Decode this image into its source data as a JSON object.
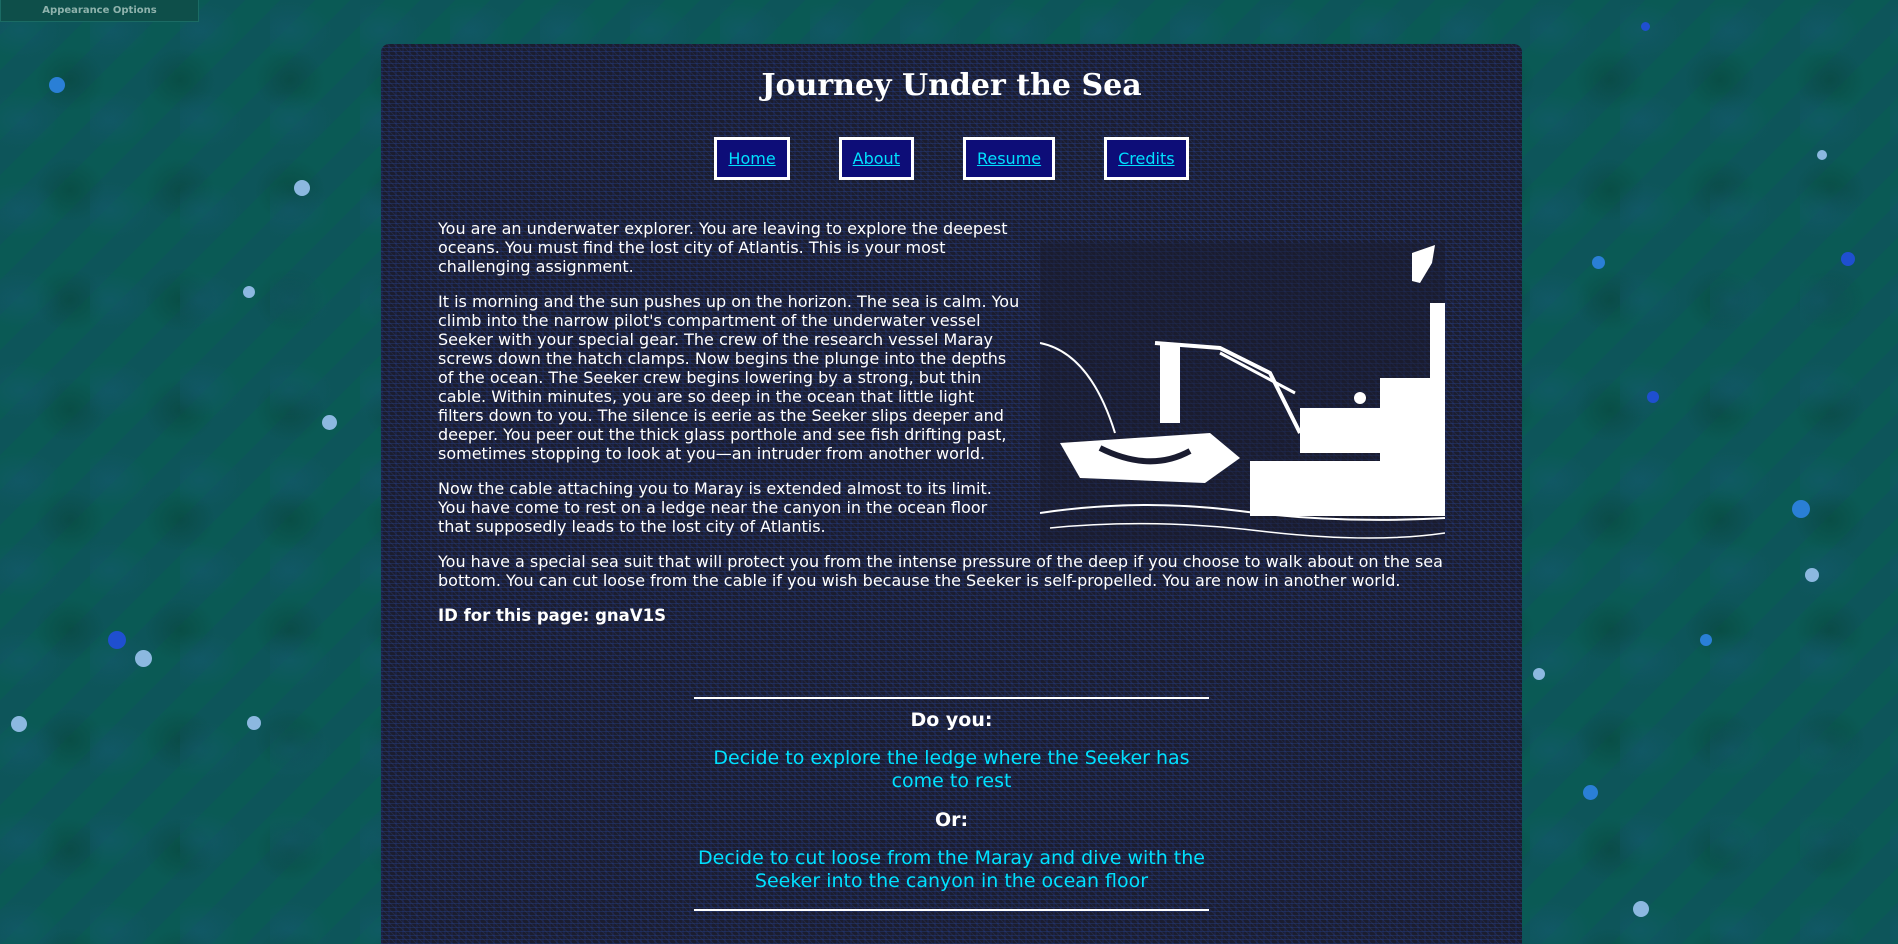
{
  "appearance": {
    "label": "Appearance Options"
  },
  "page": {
    "title": "Journey Under the Sea",
    "nav": [
      "Home",
      "About",
      "Resume",
      "Credits"
    ],
    "paragraphs": [
      "You are an underwater explorer. You are leaving to explore the deepest oceans. You must find the lost city of Atlantis. This is your most challenging assignment.",
      "It is morning and the sun pushes up on the horizon. The sea is calm. You climb into the narrow pilot's compartment of the underwater vessel Seeker with your special gear. The crew of the research vessel Maray screws down the hatch clamps. Now begins the plunge into the depths of the ocean. The Seeker crew begins lowering by a strong, but thin cable. Within minutes, you are so deep in the ocean that little light filters down to you. The silence is eerie as the Seeker slips deeper and deeper. You peer out the thick glass porthole and see fish drifting past, sometimes stopping to look at you—an intruder from another world.",
      "Now the cable attaching you to Maray is extended almost to its limit. You have come to rest on a ledge near the canyon in the ocean floor that supposedly leads to the lost city of Atlantis.",
      "You have a special sea suit that will protect you from the intense pressure of the deep if you choose to walk about on the sea bottom. You can cut loose from the cable if you wish because the Seeker is self-propelled. You are now in another world."
    ],
    "page_id": "ID for this page: gnaV1S",
    "prompt": "Do you:",
    "choice_1": "Decide to explore the ledge where the Seeker has come to rest",
    "or_label": "Or:",
    "choice_2": "Decide to cut loose from the Maray and dive with the Seeker into the canyon in the ocean floor"
  },
  "colors": {
    "link": "#00e0ff",
    "nav_bg": "#0d0d78",
    "page_bg": "#0a5a55",
    "panel_bg": "#1b1d2f"
  },
  "icons": {
    "illustration": "ship-illustration"
  }
}
